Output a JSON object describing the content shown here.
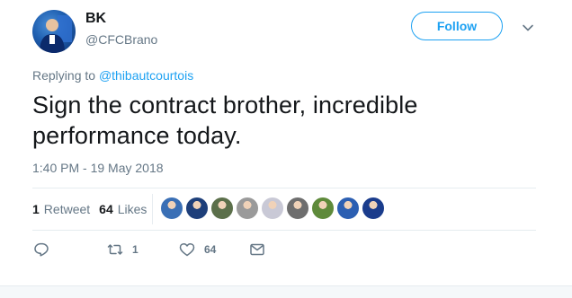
{
  "user": {
    "name": "BK",
    "handle": "@CFCBrano"
  },
  "follow_button": {
    "label": "Follow"
  },
  "reply": {
    "prefix": "Replying to ",
    "to_handle": "@thibautcourtois"
  },
  "tweet": {
    "text_line1": "Sign the contract brother, incredible",
    "text_line2": "performance today.",
    "timestamp": "1:40 PM - 19 May 2018"
  },
  "stats": {
    "retweets_count": "1",
    "retweets_label": "Retweet",
    "likes_count": "64",
    "likes_label": "Likes"
  },
  "likers": [
    {
      "icon": "liker-avatar",
      "color": "#3a6fb5"
    },
    {
      "icon": "liker-avatar",
      "color": "#1e3f7a"
    },
    {
      "icon": "liker-avatar",
      "color": "#5b6f4a"
    },
    {
      "icon": "liker-avatar",
      "color": "#9a9a9a"
    },
    {
      "icon": "liker-avatar",
      "color": "#c9c9d6"
    },
    {
      "icon": "liker-avatar",
      "color": "#6e6e6e"
    },
    {
      "icon": "liker-avatar",
      "color": "#5e8a3a"
    },
    {
      "icon": "liker-avatar",
      "color": "#2c5fb2"
    },
    {
      "icon": "liker-avatar",
      "color": "#1a3c8c"
    }
  ],
  "actions": {
    "reply_icon": "reply-icon",
    "retweet_icon": "retweet-icon",
    "retweet_count": "1",
    "like_icon": "heart-icon",
    "like_count": "64",
    "dm_icon": "envelope-icon"
  },
  "colors": {
    "accent": "#1da1f2",
    "text": "#14171a",
    "secondary": "#657786",
    "divider": "#e6ecf0"
  }
}
